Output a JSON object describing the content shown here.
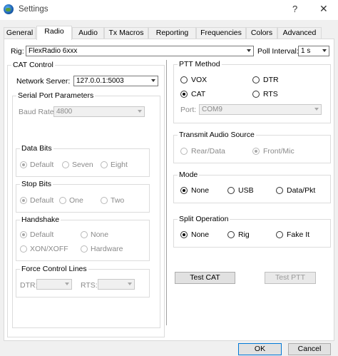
{
  "window": {
    "title": "Settings",
    "help": "?",
    "close": "✕"
  },
  "tabs": [
    "General",
    "Radio",
    "Audio",
    "Tx Macros",
    "Reporting",
    "Frequencies",
    "Colors",
    "Advanced"
  ],
  "rig": {
    "label": "Rig:",
    "value": "FlexRadio 6xxx",
    "poll_label": "Poll Interval:",
    "poll_value": "1 s"
  },
  "cat": {
    "title": "CAT Control",
    "network_label": "Network Server:",
    "network_value": "127.0.0.1:5003",
    "serial_title": "Serial Port Parameters",
    "baud_label": "Baud Rate:",
    "baud_value": "4800",
    "data_bits": {
      "title": "Data Bits",
      "options": [
        "Default",
        "Seven",
        "Eight"
      ]
    },
    "stop_bits": {
      "title": "Stop Bits",
      "options": [
        "Default",
        "One",
        "Two"
      ]
    },
    "handshake": {
      "title": "Handshake",
      "options": [
        "Default",
        "None",
        "XON/XOFF",
        "Hardware"
      ]
    },
    "force": {
      "title": "Force Control Lines",
      "dtr_label": "DTR:",
      "rts_label": "RTS:"
    }
  },
  "ptt": {
    "title": "PTT Method",
    "options": [
      "VOX",
      "DTR",
      "CAT",
      "RTS"
    ],
    "selected": "CAT",
    "port_label": "Port:",
    "port_value": "COM9"
  },
  "audio_source": {
    "title": "Transmit Audio Source",
    "options": [
      "Rear/Data",
      "Front/Mic"
    ],
    "selected": "Front/Mic"
  },
  "mode": {
    "title": "Mode",
    "options": [
      "None",
      "USB",
      "Data/Pkt"
    ],
    "selected": "None"
  },
  "split": {
    "title": "Split Operation",
    "options": [
      "None",
      "Rig",
      "Fake It"
    ],
    "selected": "None"
  },
  "buttons": {
    "test_cat": "Test CAT",
    "test_ptt": "Test PTT",
    "ok": "OK",
    "cancel": "Cancel"
  }
}
